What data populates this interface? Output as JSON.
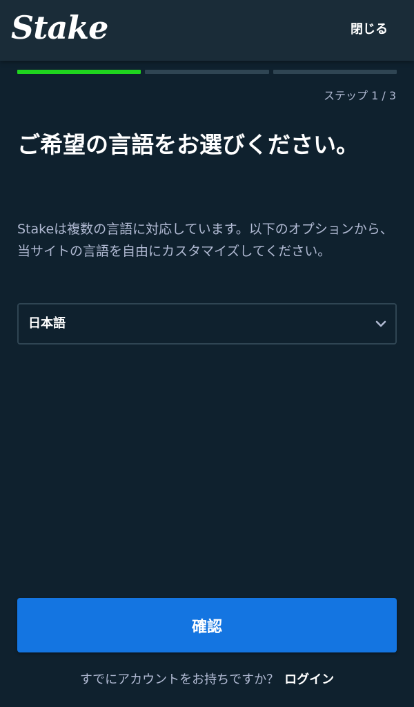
{
  "header": {
    "logo_text": "Stake",
    "close_label": "閉じる"
  },
  "progress": {
    "current_step": 1,
    "total_steps": 3,
    "step_label": "ステップ 1 / 3"
  },
  "main": {
    "title": "ご希望の言語をお選びください。",
    "description": "Stakeは複数の言語に対応しています。以下のオプションから、当サイトの言語を自由にカスタマイズしてください。",
    "language_select": {
      "selected": "日本語",
      "icon": "chevron-down-icon"
    }
  },
  "actions": {
    "confirm_label": "確認"
  },
  "footer": {
    "prompt": "すでにアカウントをお持ちですか？",
    "login_label": "ログイン"
  },
  "colors": {
    "background": "#0f212e",
    "header": "#1a2c38",
    "progress_active": "#1fd41f",
    "progress_inactive": "#2f4553",
    "button": "#1475e1",
    "muted_text": "#b1bad3"
  }
}
